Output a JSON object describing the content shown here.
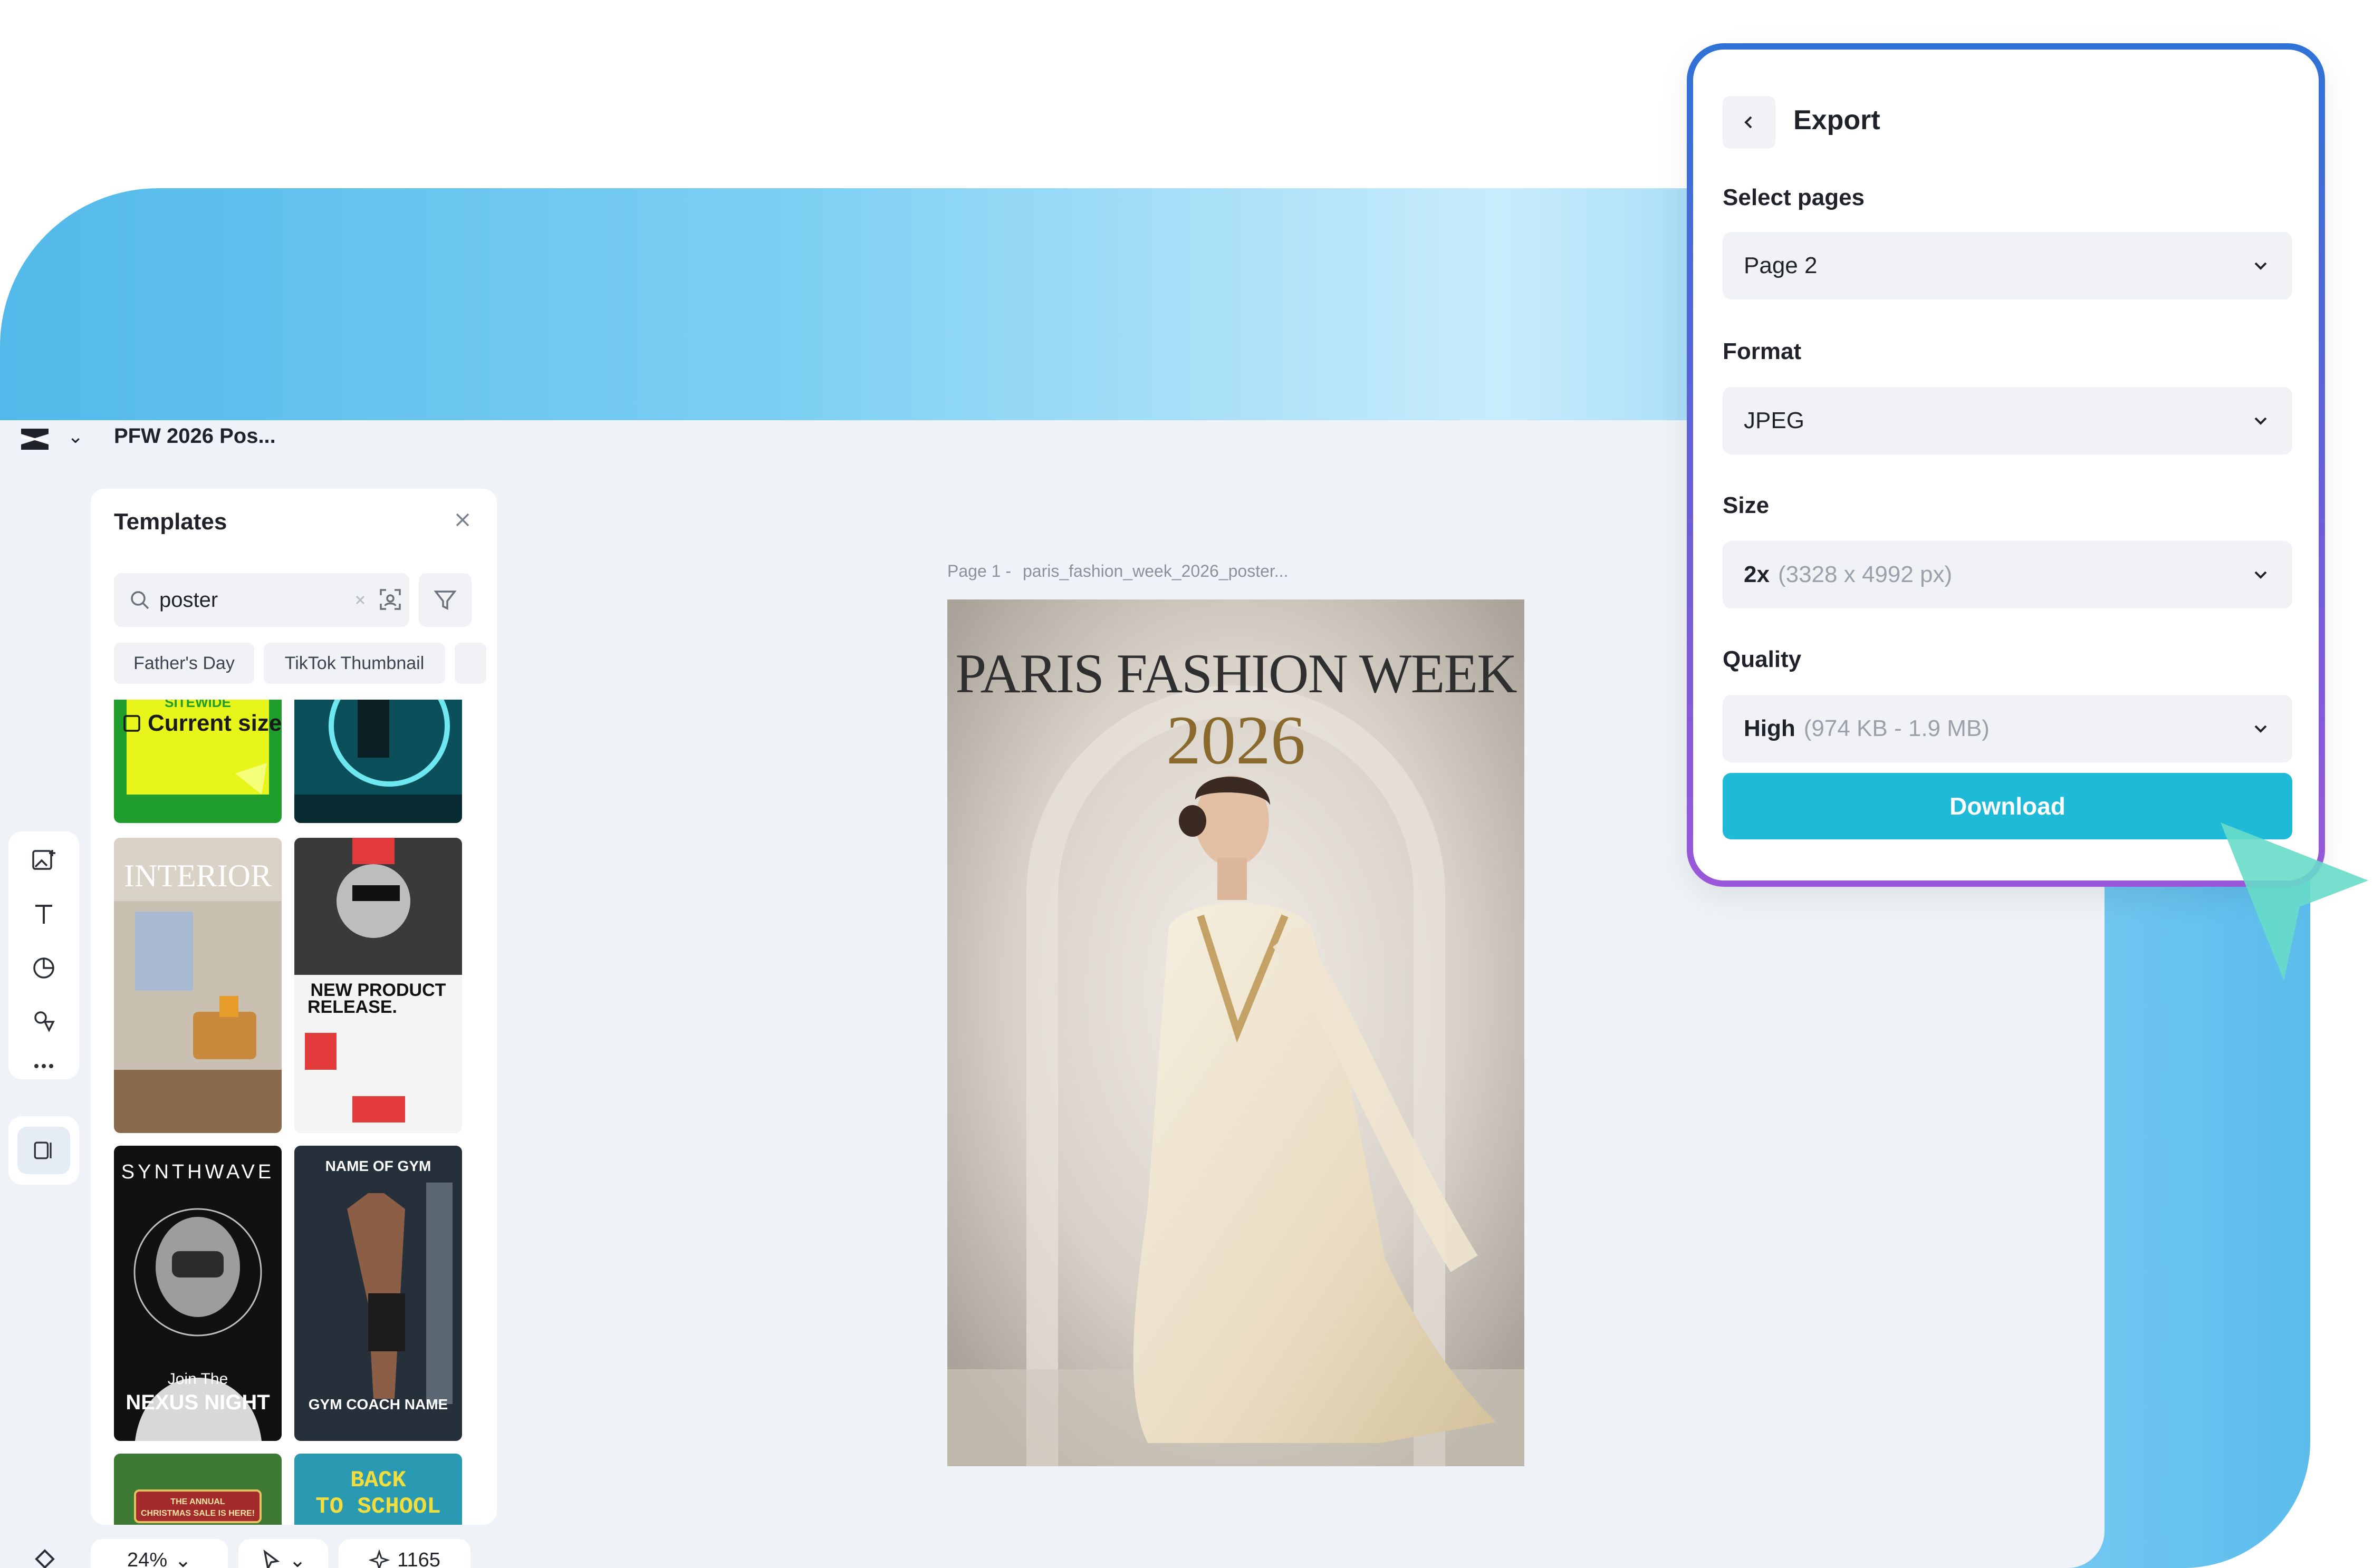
{
  "editor": {
    "doc_title": "PFW 2026 Pos...",
    "canvas": {
      "page_label": "Page 1 -",
      "file_name": "paris_fashion_week_2026_poster...",
      "poster_title": "PARIS FASHION WEEK",
      "poster_year": "2026"
    },
    "rail": {
      "items": [
        "image-add-icon",
        "text-icon",
        "shapes-icon",
        "elements-icon",
        "more-icon",
        "panel-toggle-icon"
      ]
    },
    "bottom_bar": {
      "zoom": "24%",
      "count": "1165"
    }
  },
  "templates_panel": {
    "title": "Templates",
    "search": {
      "value": "poster"
    },
    "chips": [
      "Father's Day",
      "TikTok Thumbnail"
    ],
    "overlay_label": "Current size",
    "thumbnails": [
      {
        "text": "SITEWIDE",
        "bg": "#c9e51c"
      },
      {
        "text": "",
        "bg": "#0d5a66"
      },
      {
        "text": "INTERIOR",
        "bg": "#c8bfb1"
      },
      {
        "text": "NEW PRODUCT RELEASE.",
        "bg": "#f2f2f2"
      },
      {
        "text": "SYNTHWAVE",
        "text2": "Join The",
        "text3": "NEXUS NIGHT",
        "bg": "#141414"
      },
      {
        "text": "NAME OF GYM",
        "text2": "GYM COACH NAME",
        "bg": "#2b3540"
      },
      {
        "text": "THE ANNUAL CHRISTMAS SALE IS HERE!",
        "bg": "#3f7a34"
      },
      {
        "text": "BACK TO SCHOOL",
        "bg": "#2c9bb4"
      }
    ]
  },
  "export_panel": {
    "title": "Export",
    "select_pages": {
      "label": "Select pages",
      "value": "Page 2"
    },
    "format": {
      "label": "Format",
      "value": "JPEG"
    },
    "size": {
      "label": "Size",
      "value": "2x",
      "detail": "(3328 x 4992 px)"
    },
    "quality": {
      "label": "Quality",
      "value": "High",
      "detail": "(974 KB - 1.9 MB)"
    },
    "download_label": "Download",
    "accent": "#1fbad8"
  }
}
